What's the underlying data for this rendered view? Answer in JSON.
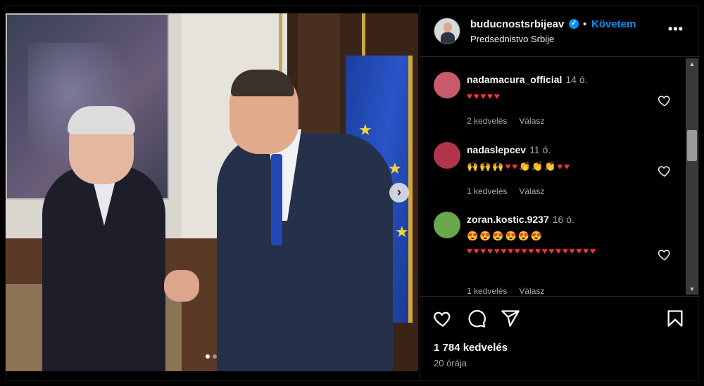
{
  "post": {
    "slide_indicator": {
      "current": 1,
      "total": 2
    }
  },
  "header": {
    "username": "buducnostsrbijeav",
    "verified_mark": "✓",
    "separator": "•",
    "follow_label": "Követem",
    "subtitle": "Predsednistvo Srbije",
    "more_label": "•••"
  },
  "comments": [
    {
      "user": "nadamacura_official",
      "time": "14 ó.",
      "text": "♥♥♥♥♥",
      "likes": "2 kedvelés",
      "reply": "Válasz",
      "avatar_color": "#c85a6a"
    },
    {
      "user": "nadaslepcev",
      "time": "11 ó.",
      "text": "🙌🙌🙌♥♥👏👏👏♥♥",
      "likes": "1 kedvelés",
      "reply": "Válasz",
      "avatar_color": "#b2344a"
    },
    {
      "user": "zoran.kostic.9237",
      "time": "16 ó.",
      "text": "😍😍😍😍😍😍♥♥♥♥♥♥♥♥♥♥♥♥♥♥♥♥♥♥♥",
      "likes": "1 kedvelés",
      "reply": "Válasz",
      "avatar_color": "#6aa64a"
    }
  ],
  "actions": {
    "likes_count": "1 784 kedvelés",
    "time_ago": "20 órája"
  },
  "colors": {
    "accent": "#0095f6",
    "heart": "#ff3040",
    "background": "#000000",
    "muted_text": "#a8a8a8"
  },
  "icons": [
    "verified-badge-icon",
    "more-options-icon",
    "heart-icon",
    "comment-icon",
    "share-icon",
    "bookmark-icon",
    "chevron-right-icon"
  ]
}
